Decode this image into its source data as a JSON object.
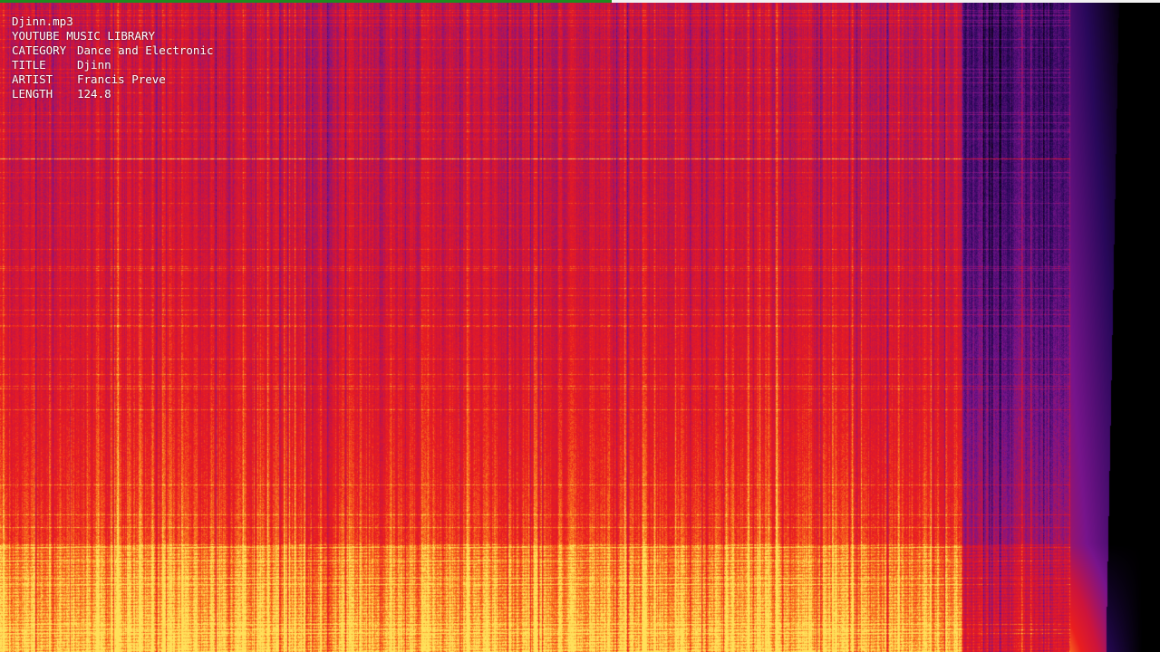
{
  "file": {
    "name": "Djinn.mp3",
    "library": "YOUTUBE MUSIC LIBRARY"
  },
  "meta": {
    "category_label": "CATEGORY",
    "category_value": "Dance and Electronic",
    "title_label": "TITLE",
    "title_value": "Djinn",
    "artist_label": "ARTIST",
    "artist_value": "Francis Preve",
    "length_label": "LENGTH",
    "length_value": "124.8"
  },
  "playback": {
    "progress": 0.527
  },
  "colors": {
    "progress_played": "#1f8a1f",
    "progress_track": "#f2f2f2",
    "spectrum_low": "#000000",
    "spectrum_mid": "#7a1a8a",
    "spectrum_high": "#e3102a",
    "spectrum_peak": "#ffd24a"
  }
}
